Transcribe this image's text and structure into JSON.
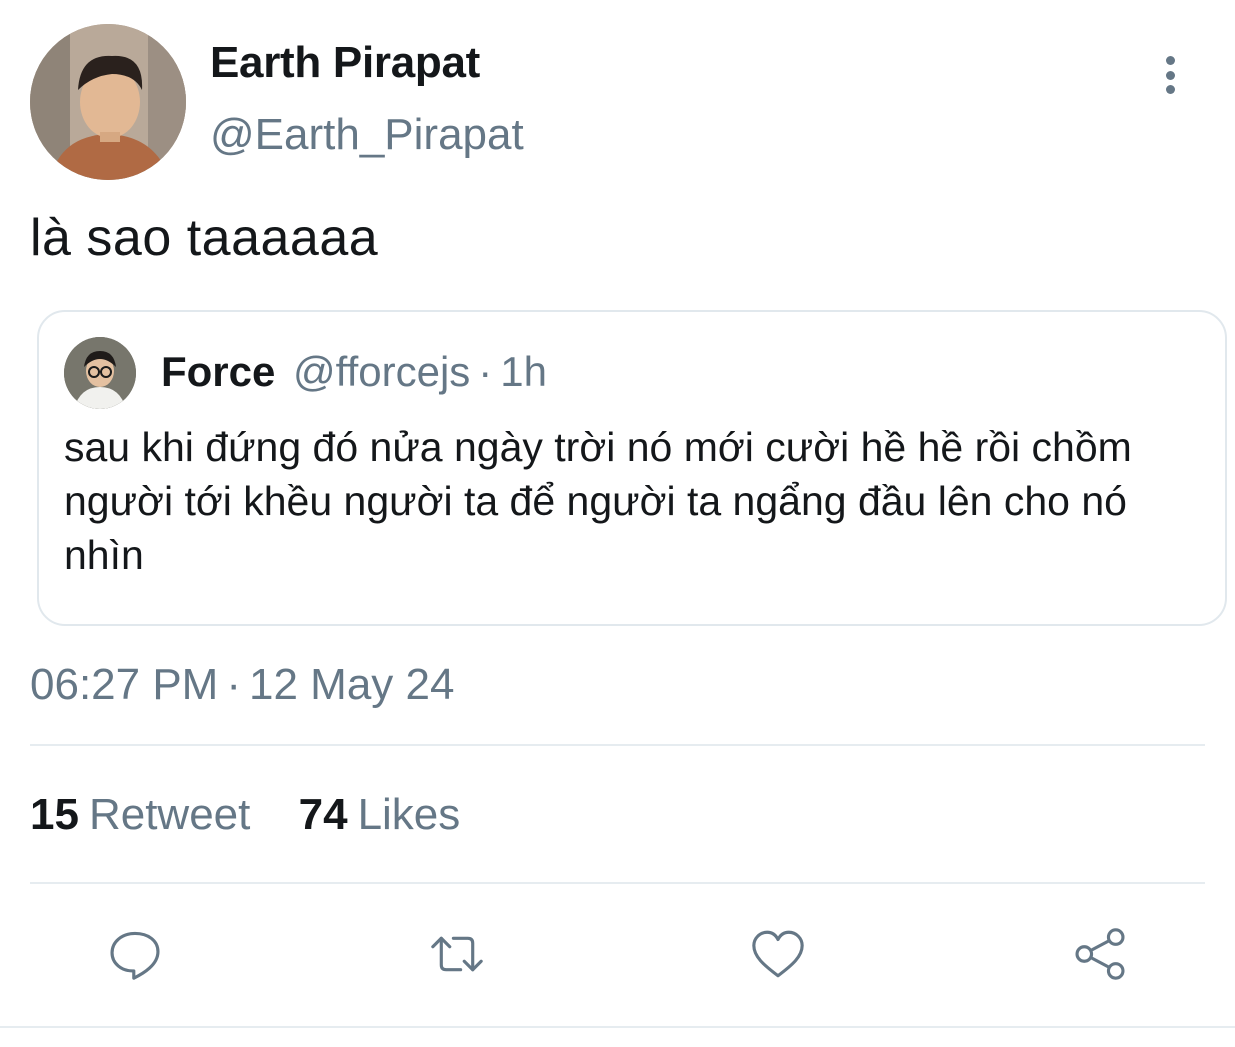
{
  "author": {
    "name": "Earth Pirapat",
    "handle": "@Earth_Pirapat"
  },
  "tweet": {
    "text": "là sao taaaaaa",
    "time": "06:27 PM",
    "separator": "·",
    "date": "12 May 24"
  },
  "quoted_tweet": {
    "name": "Force",
    "handle": "@fforcejs",
    "separator": "·",
    "age": "1h",
    "text": "sau khi đứng đó nửa ngày trời nó mới cười hề hề rồi chồm người tới khều người ta để người ta ngẩng đầu lên cho nó nhìn"
  },
  "stats": {
    "retweet_count": "15",
    "retweet_label": "Retweet",
    "likes_count": "74",
    "likes_label": "Likes"
  },
  "actions": {
    "reply_icon": "speech-bubble",
    "retweet_icon": "retweet-arrows",
    "like_icon": "heart",
    "share_icon": "share-nodes"
  },
  "colors": {
    "primary_text": "#14171a",
    "secondary_text": "#657786",
    "border": "#e1e8ed"
  }
}
